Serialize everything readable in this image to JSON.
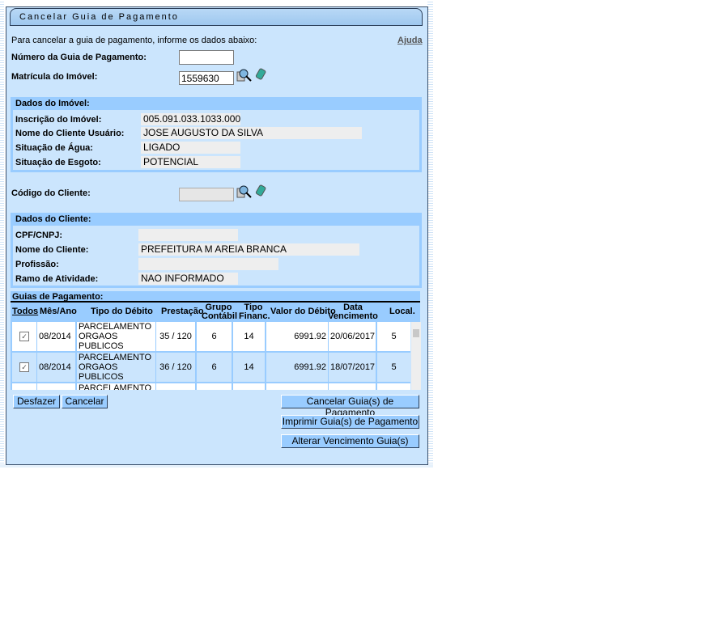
{
  "title": "Cancelar Guia de Pagamento",
  "instruction": "Para cancelar a guia de pagamento, informe os dados abaixo:",
  "help_link": "Ajuda",
  "form": {
    "numero_guia_label": "Número da Guia de Pagamento:",
    "numero_guia_value": "",
    "matricula_label": "Matrícula do Imóvel:",
    "matricula_value": "1559630",
    "codigo_cliente_label": "Código do Cliente:",
    "codigo_cliente_value": ""
  },
  "imovel": {
    "header": "Dados do Imóvel:",
    "fields": [
      {
        "label": "Inscrição do Imóvel:",
        "value": "005.091.033.1033.000"
      },
      {
        "label": "Nome do Cliente Usuário:",
        "value": "JOSE AUGUSTO DA SILVA"
      },
      {
        "label": "Situação de Água:",
        "value": "LIGADO"
      },
      {
        "label": "Situação de Esgoto:",
        "value": "POTENCIAL"
      }
    ]
  },
  "cliente": {
    "header": "Dados do Cliente:",
    "fields": [
      {
        "label": "CPF/CNPJ:",
        "value": ""
      },
      {
        "label": "Nome do Cliente:",
        "value": "PREFEITURA M AREIA BRANCA"
      },
      {
        "label": "Profissão:",
        "value": ""
      },
      {
        "label": "Ramo de Atividade:",
        "value": "NAO INFORMADO"
      }
    ]
  },
  "guias": {
    "header": "Guias de Pagamento:",
    "columns": [
      "Todos",
      "Mês/Ano",
      "Tipo do Débito",
      "Prestação",
      "Grupo Contábil",
      "Tipo Financ.",
      "Valor do Débito",
      "Data Vencimento",
      "Local."
    ],
    "rows": [
      {
        "checked": true,
        "mes": "08/2014",
        "tipo": "PARCELAMENTO ORGAOS PUBLICOS",
        "prest": "35 / 120",
        "grupo": "6",
        "financ": "14",
        "valor": "6991.92",
        "venc": "20/06/2017",
        "local": "5"
      },
      {
        "checked": true,
        "mes": "08/2014",
        "tipo": "PARCELAMENTO ORGAOS PUBLICOS",
        "prest": "36 / 120",
        "grupo": "6",
        "financ": "14",
        "valor": "6991.92",
        "venc": "18/07/2017",
        "local": "5"
      },
      {
        "checked": false,
        "mes": "",
        "tipo": "PARCELAMENTO",
        "prest": "",
        "grupo": "",
        "financ": "",
        "valor": "",
        "venc": "",
        "local": ""
      }
    ]
  },
  "buttons": {
    "desfazer": "Desfazer",
    "cancelar": "Cancelar",
    "cancelar_guias": "Cancelar Guia(s) de Pagamento",
    "imprimir_guias": "Imprimir Guia(s) de Pagamento",
    "alterar_venc": "Alterar Vencimento Guia(s)"
  }
}
